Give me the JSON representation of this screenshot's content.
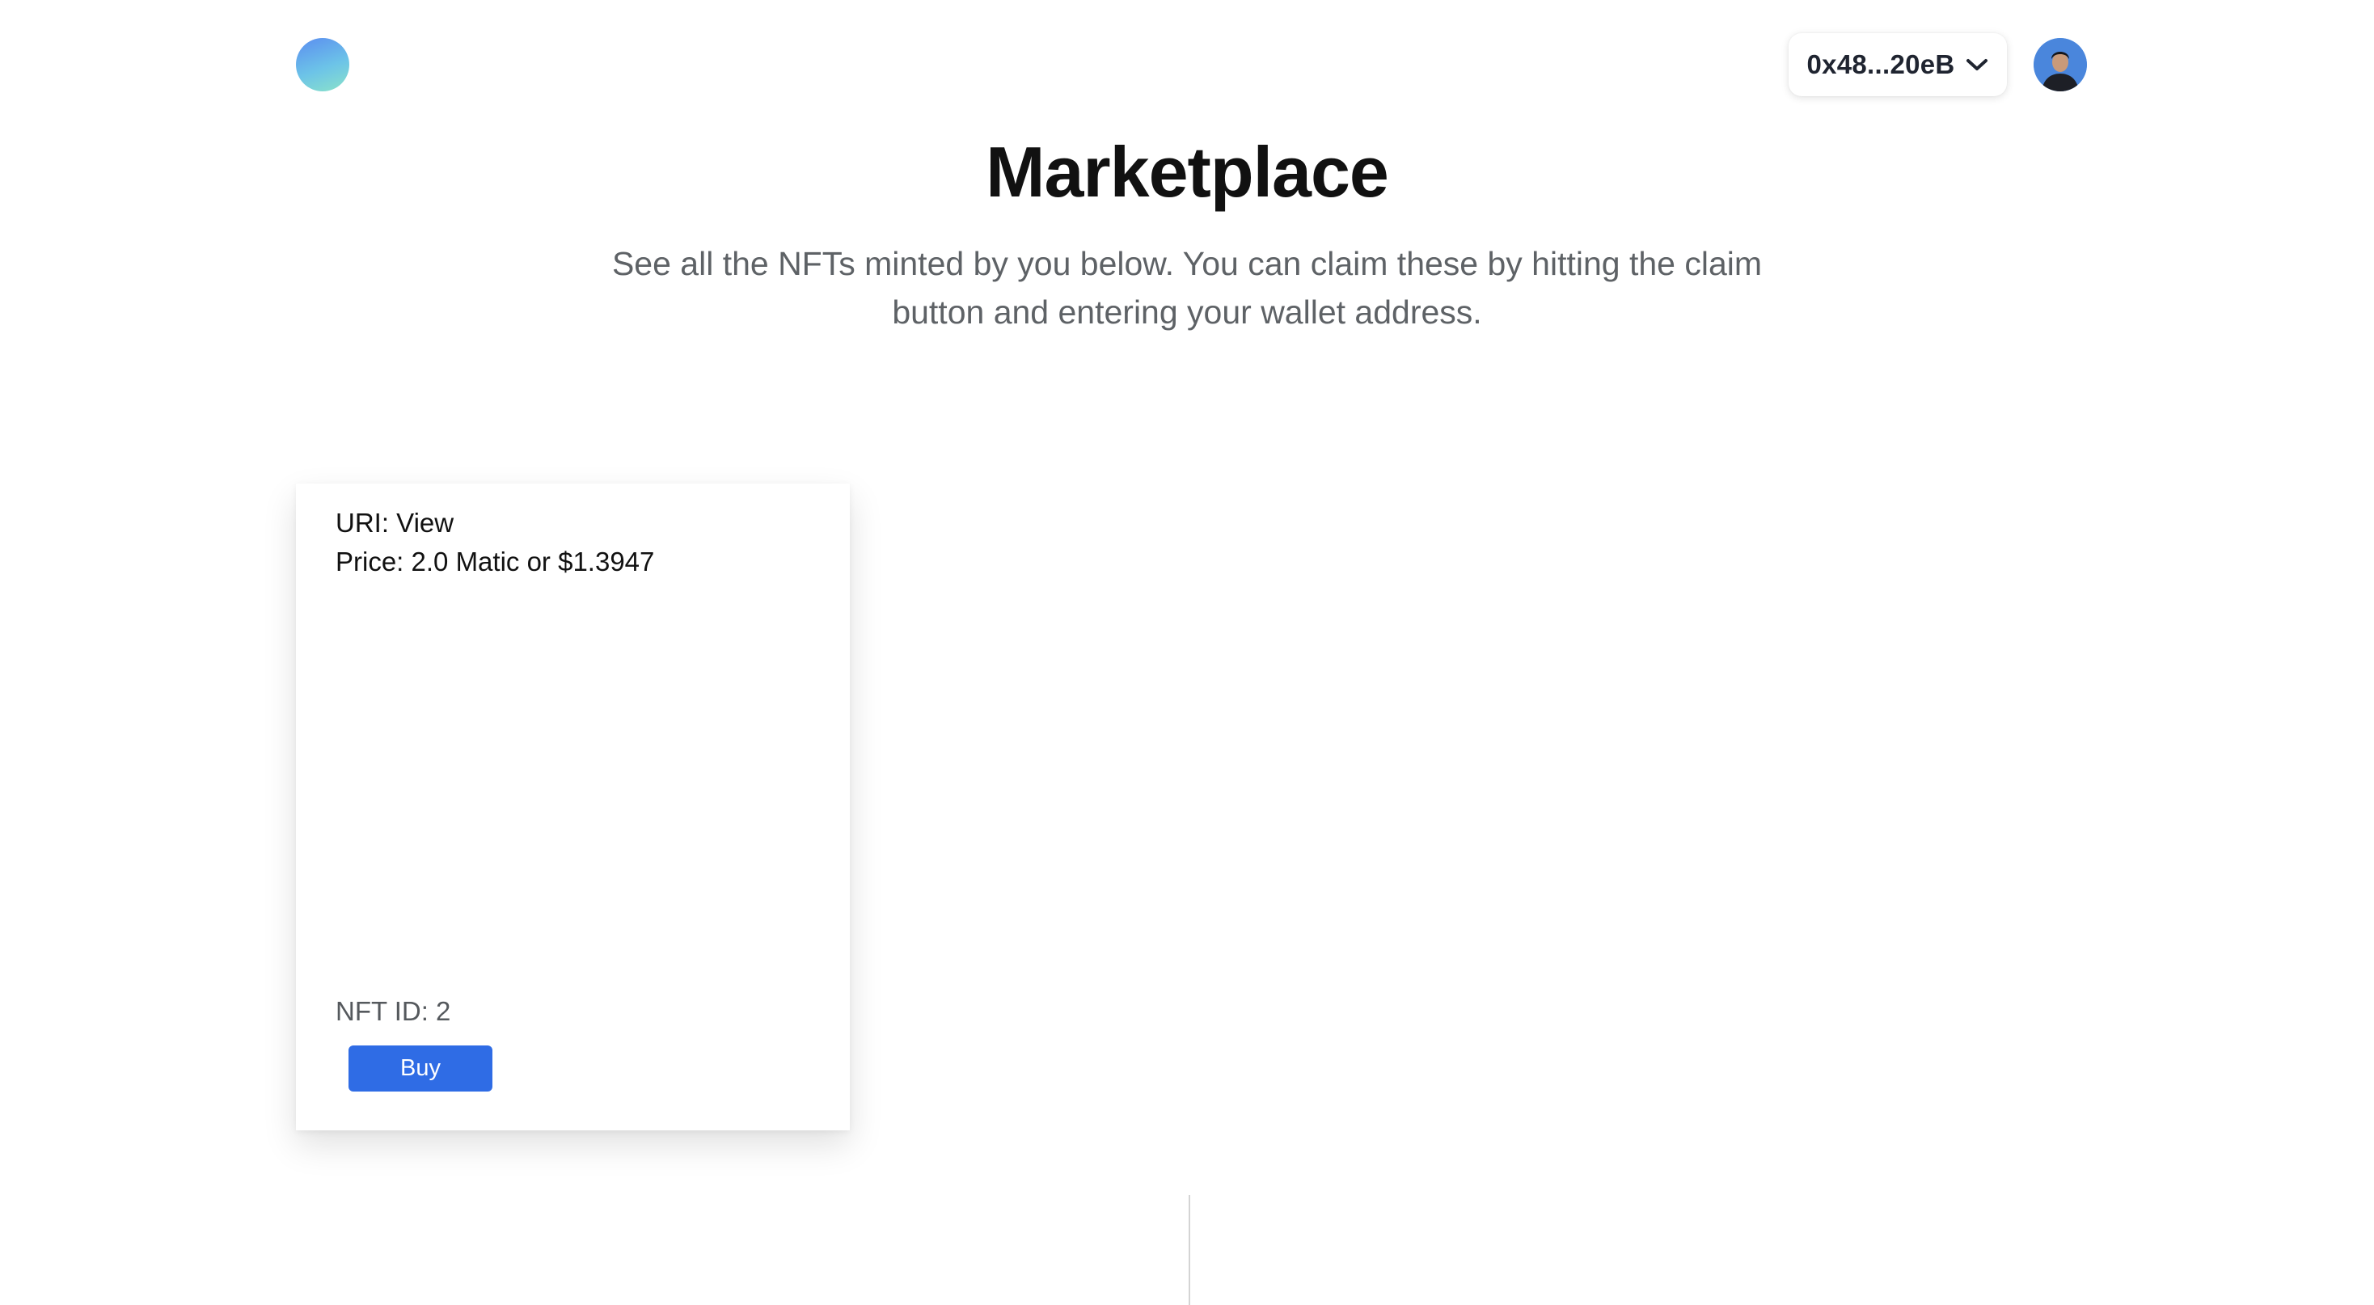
{
  "header": {
    "wallet_address": "0x48...20eB",
    "wallet_chevron_icon": "chevron-down-icon",
    "logo_icon": "gradient-circle-logo",
    "avatar_icon": "user-avatar",
    "colors": {
      "logo_gradient": [
        "#5b8df0",
        "#6cc3e8",
        "#8be3c9"
      ]
    }
  },
  "main": {
    "title": "Marketplace",
    "subtitle": "See all the NFTs minted by you below. You can claim these by hitting the claim button and entering your wallet address."
  },
  "nfts": [
    {
      "uri_line": "URI: View",
      "price_line": "Price: 2.0 Matic or $1.3947",
      "id_line": "NFT ID: 2",
      "buy_label": "Buy"
    }
  ],
  "colors": {
    "accent": "#2f6ce5",
    "title": "#111111",
    "subtitle": "#5e6266"
  }
}
